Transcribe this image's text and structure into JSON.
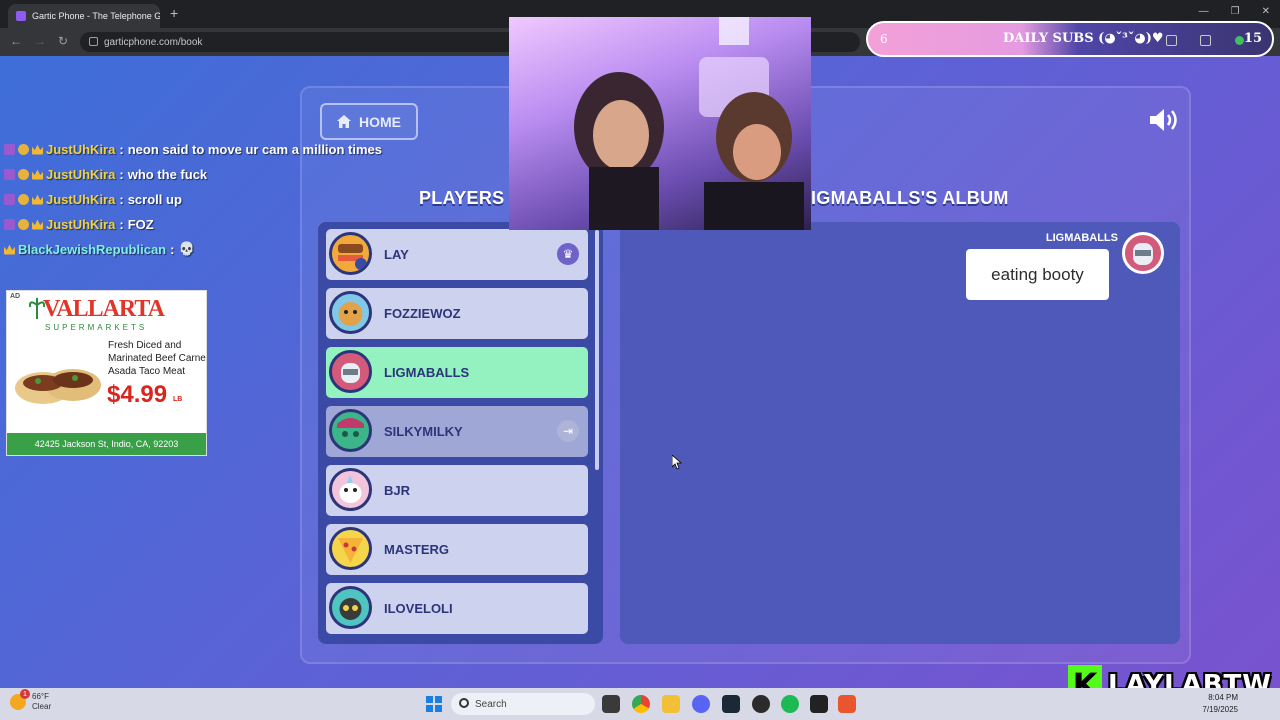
{
  "browser": {
    "tab_title": "Gartic Phone - The Telephone G",
    "new_tab": "+",
    "url": "garticphone.com/book",
    "window_controls": [
      "—",
      "❐",
      "✕"
    ]
  },
  "subs_overlay": {
    "count": "6",
    "label": "DAILY SUBS (◕ˇ³ˇ◕)♥",
    "goal": "15"
  },
  "game": {
    "home_label": "HOME",
    "players_heading": "PLAYERS",
    "album_heading": "IGMABALLS'S ALBUM",
    "players": [
      {
        "name": "LAY",
        "badge": "♛",
        "state": "normal"
      },
      {
        "name": "FOZZIEWOZ",
        "badge": "",
        "state": "normal"
      },
      {
        "name": "LIGMABALLS",
        "badge": "",
        "state": "active"
      },
      {
        "name": "SILKYMILKY",
        "badge": "⇥",
        "state": "dim"
      },
      {
        "name": "BJR",
        "badge": "",
        "state": "normal"
      },
      {
        "name": "MASTERG",
        "badge": "",
        "state": "normal"
      },
      {
        "name": "ILOVELOLI",
        "badge": "",
        "state": "normal"
      }
    ],
    "album_entry": {
      "author": "LIGMABALLS",
      "text": "eating booty"
    }
  },
  "chat": [
    {
      "user": "JustUhKira",
      "text": "neon said to move ur cam a million times"
    },
    {
      "user": "JustUhKira",
      "text": "who the fuck"
    },
    {
      "user": "JustUhKira",
      "text": "scroll up"
    },
    {
      "user": "JustUhKira",
      "text": "FOZ"
    },
    {
      "user": "BlackJewishRepublican",
      "text": "💀"
    }
  ],
  "ad": {
    "tag": "AD",
    "brand": "VALLARTA",
    "brand_sub": "SUPERMARKETS",
    "description": "Fresh Diced and Marinated Beef Carne Asada Taco Meat",
    "price": "$4.99",
    "unit": "LB",
    "address": "42425 Jackson St, Indio, CA, 92203"
  },
  "taskbar": {
    "temperature": "66°F",
    "condition": "Clear",
    "weather_badge": "1",
    "search_label": "Search",
    "time": "8:04 PM",
    "date": "7/19/2025"
  },
  "watermark": {
    "logo_letter": "K",
    "text": "LAYLABTW"
  }
}
